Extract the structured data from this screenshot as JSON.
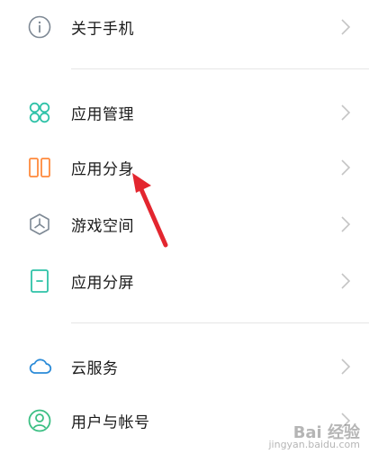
{
  "settings": {
    "items": [
      {
        "label": "关于手机",
        "icon": "info-icon"
      },
      {
        "label": "应用管理",
        "icon": "app-grid-icon"
      },
      {
        "label": "应用分身",
        "icon": "dual-app-icon"
      },
      {
        "label": "游戏空间",
        "icon": "game-space-icon"
      },
      {
        "label": "应用分屏",
        "icon": "split-screen-icon"
      },
      {
        "label": "云服务",
        "icon": "cloud-icon"
      },
      {
        "label": "用户与帐号",
        "icon": "user-account-icon"
      }
    ]
  },
  "colors": {
    "teal": "#2fc2a8",
    "orange": "#ff8a3d",
    "gray_icon": "#7d8894",
    "blue": "#2b8bd8",
    "green": "#3bbf83",
    "arrow_red": "#e3262f",
    "chevron": "#c4c4c4"
  },
  "watermark": {
    "logo": "Bai 经验",
    "url": "jingyan.baidu.com"
  }
}
